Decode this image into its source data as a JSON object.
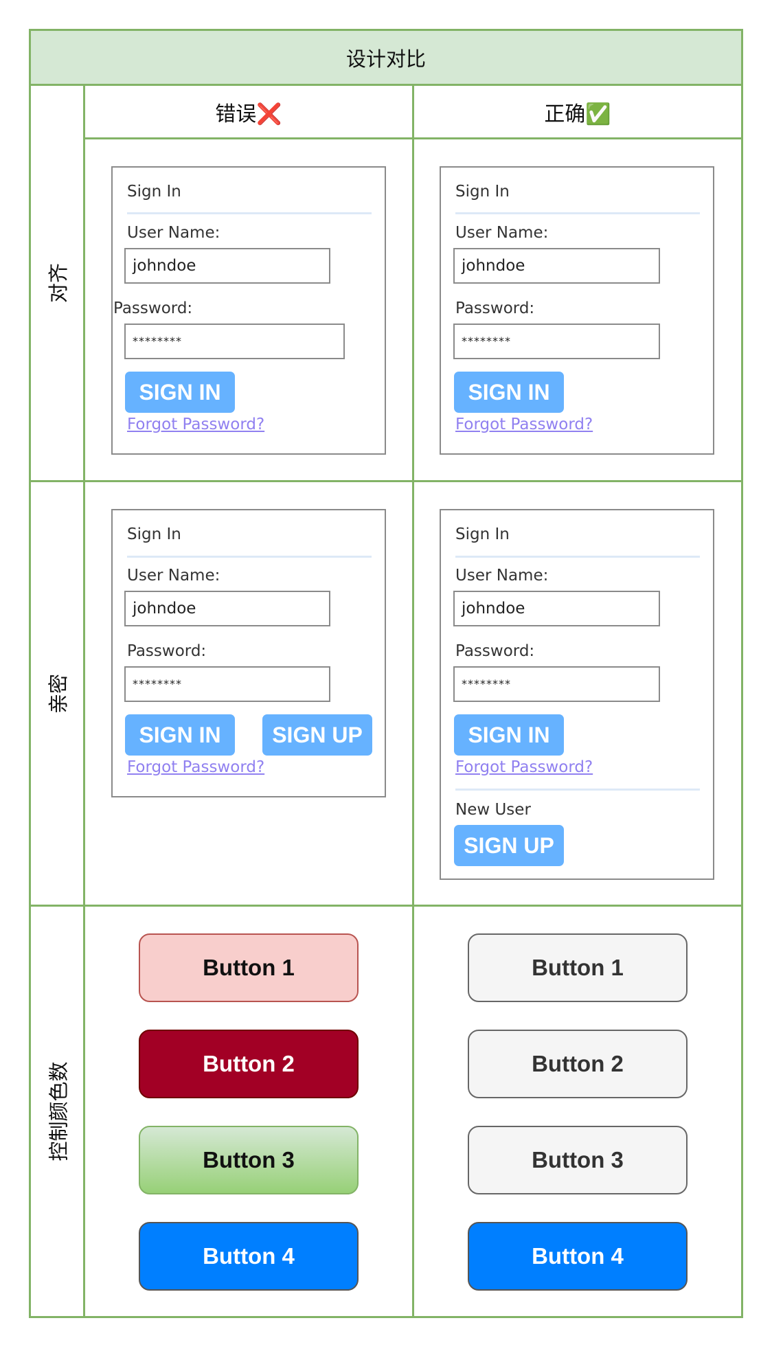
{
  "title": "设计对比",
  "columns": {
    "wrong": "错误❌",
    "right": "正确✅"
  },
  "rows": {
    "alignment": "对齐",
    "proximity": "亲密",
    "color_count": "控制颜色数"
  },
  "form": {
    "title": "Sign In",
    "username_label": "User Name:",
    "username_value": "johndoe",
    "password_label": "Password:",
    "password_value": "********",
    "sign_in": "SIGN IN",
    "sign_up": "SIGN UP",
    "forgot": "Forgot Password?",
    "new_user": "New User"
  },
  "buttons": {
    "b1": "Button 1",
    "b2": "Button 2",
    "b3": "Button 3",
    "b4": "Button 4"
  },
  "colors": {
    "border_green": "#82b366",
    "header_fill": "#d5e8d4",
    "sign_button_blue": "#66b2ff",
    "link_purple": "#9080f0",
    "button1_wrong": "#f8cecc",
    "button2_wrong": "#a20025",
    "button3_wrong": "#97d077",
    "button4": "#007fff",
    "neutral_button": "#f5f5f5"
  }
}
